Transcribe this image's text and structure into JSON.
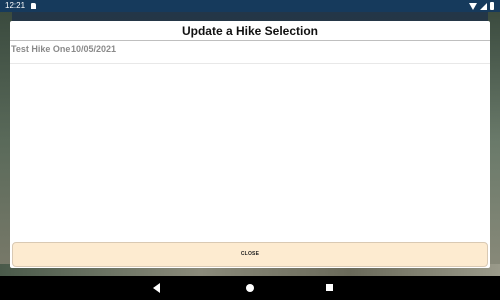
{
  "status_bar": {
    "time": "12:21"
  },
  "dialog": {
    "title": "Update a Hike Selection",
    "hikes": [
      {
        "name": "Test Hike One",
        "date": "10/05/2021"
      }
    ],
    "close_label": "CLOSE",
    "close_button_color": "#fdebd0"
  },
  "colors": {
    "status_bar": "#163a5c",
    "nav_bar": "#000000"
  }
}
